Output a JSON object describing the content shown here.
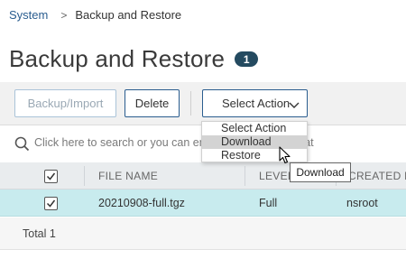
{
  "breadcrumb": {
    "parent": "System",
    "separator": ">",
    "current": "Backup and Restore"
  },
  "page": {
    "title": "Backup and Restore",
    "count": "1"
  },
  "toolbar": {
    "backup_label": "Backup/Import",
    "delete_label": "Delete",
    "action_label": "Select Action"
  },
  "search": {
    "placeholder": "Click here to search or you can enter Key : Value format"
  },
  "table": {
    "columns": [
      "FILE NAME",
      "LEVEL",
      "CREATED BY"
    ],
    "rows": [
      {
        "file_name": "20210908-full.tgz",
        "level": "Full",
        "created_by": "nsroot",
        "selected": true
      }
    ],
    "footer": "Total 1"
  },
  "action_menu": {
    "items": [
      "Select Action",
      "Download",
      "Restore"
    ],
    "hovered": "Download"
  },
  "tooltip": "Download",
  "colors": {
    "accent": "#2a5d8f",
    "badge": "#244a60",
    "selected_row": "#c8ebee"
  }
}
